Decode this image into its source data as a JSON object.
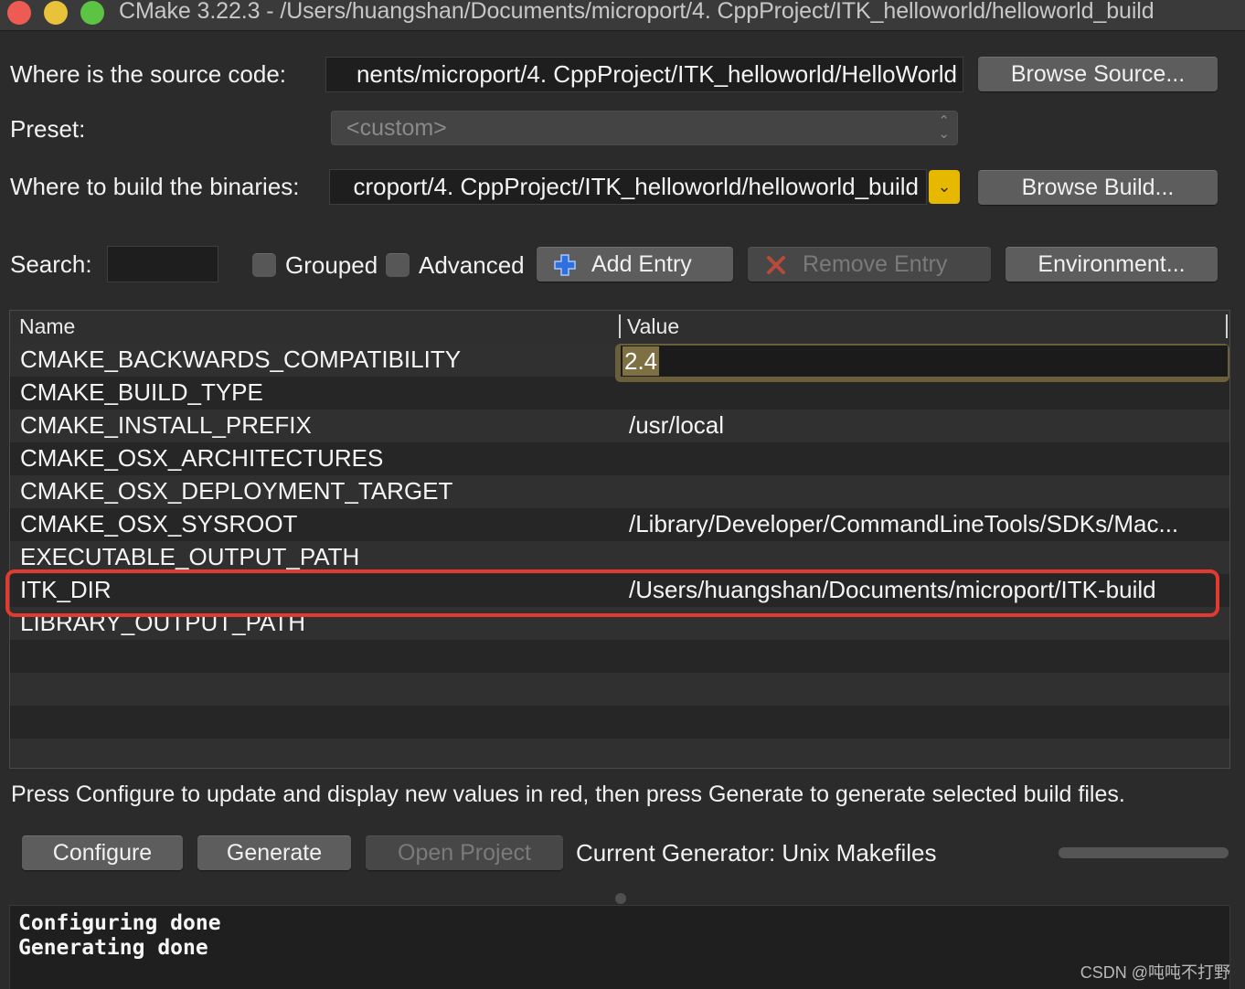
{
  "window": {
    "title": "CMake 3.22.3 - /Users/huangshan/Documents/microport/4. CppProject/ITK_helloworld/helloworld_build"
  },
  "source": {
    "label": "Where is the source code:",
    "value": "nents/microport/4. CppProject/ITK_helloworld/HelloWorld",
    "browse_label": "Browse Source..."
  },
  "preset": {
    "label": "Preset:",
    "value": "<custom>"
  },
  "build": {
    "label": "Where to build the binaries:",
    "value": "croport/4. CppProject/ITK_helloworld/helloworld_build",
    "browse_label": "Browse Build..."
  },
  "toolbar": {
    "search_label": "Search:",
    "grouped_label": "Grouped",
    "advanced_label": "Advanced",
    "add_entry_label": "Add Entry",
    "remove_entry_label": "Remove Entry",
    "environment_label": "Environment..."
  },
  "table": {
    "columns": [
      "Name",
      "Value"
    ],
    "rows": [
      {
        "name": "CMAKE_BACKWARDS_COMPATIBILITY",
        "value": "2.4"
      },
      {
        "name": "CMAKE_BUILD_TYPE",
        "value": ""
      },
      {
        "name": "CMAKE_INSTALL_PREFIX",
        "value": "/usr/local"
      },
      {
        "name": "CMAKE_OSX_ARCHITECTURES",
        "value": ""
      },
      {
        "name": "CMAKE_OSX_DEPLOYMENT_TARGET",
        "value": ""
      },
      {
        "name": "CMAKE_OSX_SYSROOT",
        "value": "/Library/Developer/CommandLineTools/SDKs/Mac..."
      },
      {
        "name": "EXECUTABLE_OUTPUT_PATH",
        "value": ""
      },
      {
        "name": "ITK_DIR",
        "value": "/Users/huangshan/Documents/microport/ITK-build"
      },
      {
        "name": "LIBRARY_OUTPUT_PATH",
        "value": ""
      }
    ]
  },
  "hint": "Press Configure to update and display new values in red, then press Generate to generate selected build files.",
  "actions": {
    "configure_label": "Configure",
    "generate_label": "Generate",
    "open_project_label": "Open Project",
    "generator_text": "Current Generator: Unix Makefiles"
  },
  "output": {
    "lines": [
      "Configuring done",
      "Generating done"
    ]
  },
  "watermark": "CSDN @吨吨不打野",
  "colors": {
    "highlight": "#e13b2f",
    "accent": "#e6b800"
  }
}
